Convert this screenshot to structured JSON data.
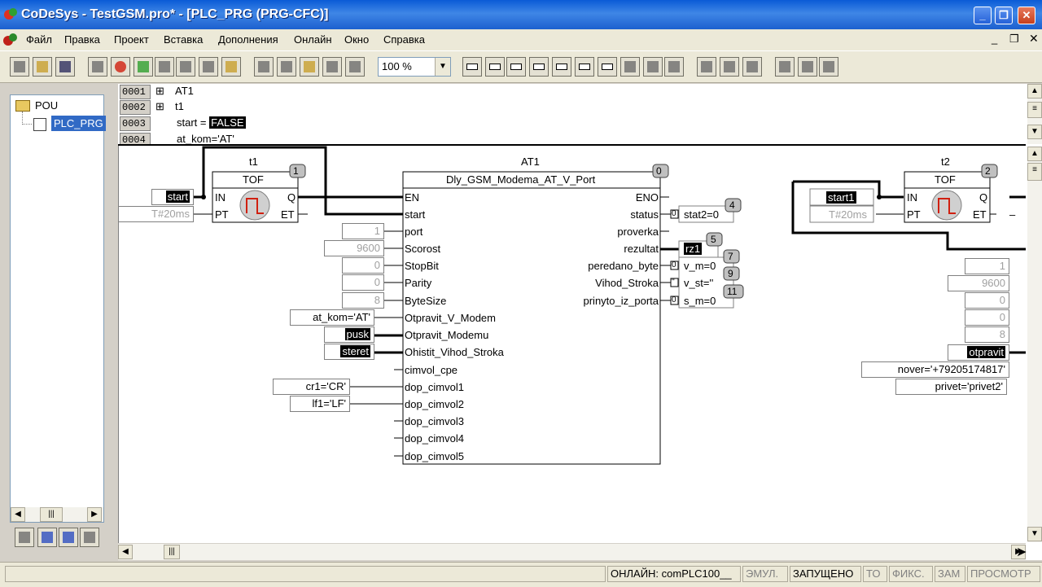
{
  "window": {
    "title": "CoDeSys - TestGSM.pro* - [PLC_PRG (PRG-CFC)]"
  },
  "menu": {
    "items": [
      "Файл",
      "Правка",
      "Проект",
      "Вставка",
      "Дополнения",
      "Онлайн",
      "Окно",
      "Справка"
    ]
  },
  "toolbar": {
    "zoom": "100 %"
  },
  "tree": {
    "root": "POU",
    "child": "PLC_PRG"
  },
  "declarations": [
    {
      "num": "0001",
      "text": "AT1",
      "expander": "⊞"
    },
    {
      "num": "0002",
      "text": "t1",
      "expander": "⊞"
    },
    {
      "num": "0003",
      "prefix": "start = ",
      "value": "FALSE"
    },
    {
      "num": "0004",
      "text": "at_kom='AT'"
    }
  ],
  "cfc": {
    "t1": {
      "name": "t1",
      "type": "TOF",
      "order": "1",
      "in_start": "start",
      "in_pt": "T#20ms",
      "pins_in": [
        "IN",
        "PT"
      ],
      "pins_out": [
        "Q",
        "ET"
      ]
    },
    "at1": {
      "name": "AT1",
      "type": "Dly_GSM_Modema_AT_V_Port",
      "order": "0",
      "inputs": [
        "EN",
        "start",
        "port",
        "Scorost",
        "StopBit",
        "Parity",
        "ByteSize",
        "Otpravit_V_Modem",
        "Otpravit_Modemu",
        "Ohistit_Vihod_Stroka",
        "cimvol_cpe",
        "dop_cimvol1",
        "dop_cimvol2",
        "dop_cimvol3",
        "dop_cimvol4",
        "dop_cimvol5"
      ],
      "outputs": [
        "ENO",
        "status",
        "proverka",
        "rezultat",
        "peredano_byte",
        "Vihod_Stroka",
        "prinyto_iz_porta"
      ]
    },
    "in_values": {
      "port": "1",
      "scorost": "9600",
      "stopbit": "0",
      "parity": "0",
      "bytesize": "8",
      "at_kom": "at_kom='AT'",
      "pusk": "pusk",
      "steret": "steret",
      "cr1": "cr1='CR'",
      "lf1": "lf1='LF'"
    },
    "out_values": {
      "stat2": "stat2=0",
      "stat2_order": "4",
      "rz1": "rz1",
      "rz1_order": "5",
      "v_m": "v_m=0",
      "v_m_order": "7",
      "v_st": "v_st=''",
      "v_st_order": "9",
      "s_m": "s_m=0",
      "s_m_order": "11",
      "zero_marker": "0",
      "quote_marker": "''"
    },
    "t2": {
      "name": "t2",
      "type": "TOF",
      "order": "2",
      "in_start": "start1",
      "in_pt": "T#20ms",
      "pins_in": [
        "IN",
        "PT"
      ],
      "pins_out": [
        "Q",
        "ET"
      ],
      "et_out": "–"
    },
    "right_values": {
      "v1": "1",
      "v2": "9600",
      "v3": "0",
      "v4": "0",
      "v5": "8",
      "otpravit": "otpravit",
      "nover": "nover='+79205174817'",
      "privet": "privet='privet2'"
    }
  },
  "status": {
    "online": "ОНЛАЙН: comPLC100__",
    "emul": "ЭМУЛ.",
    "running": "ЗАПУЩЕНО",
    "to": "ТО",
    "fix": "ФИКС.",
    "zam": "ЗАМ",
    "view": "ПРОСМОТР"
  },
  "colors": {
    "title_bar": "#1c60cf",
    "selection": "#0a246a",
    "background": "#d4d0c8"
  }
}
